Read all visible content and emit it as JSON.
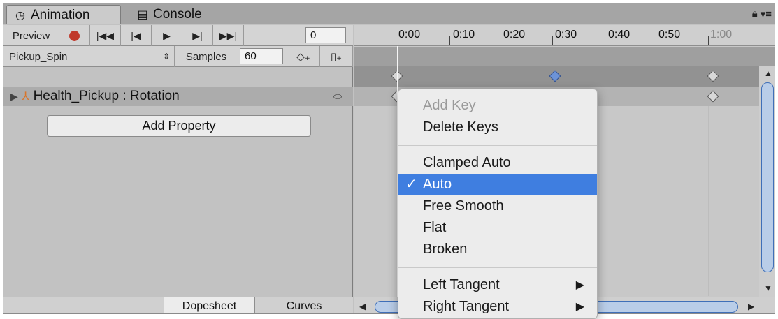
{
  "tabs": [
    {
      "label": "Animation",
      "icon": "clock-icon"
    },
    {
      "label": "Console",
      "icon": "console-icon"
    }
  ],
  "toolbar": {
    "preview_label": "Preview",
    "frame_value": "0",
    "clip_name": "Pickup_Spin",
    "samples_label": "Samples",
    "samples_value": "60"
  },
  "property": {
    "label": "Health_Pickup : Rotation"
  },
  "add_property_label": "Add Property",
  "bottom_tabs": {
    "dopesheet": "Dopesheet",
    "curves": "Curves"
  },
  "ruler": {
    "ticks": [
      "0:00",
      "0:10",
      "0:20",
      "0:30",
      "0:40",
      "0:50",
      "1:00"
    ]
  },
  "context_menu": {
    "items": [
      {
        "label": "Add Key",
        "disabled": true
      },
      {
        "label": "Delete Keys",
        "disabled": false
      },
      {
        "label": "Clamped Auto",
        "disabled": false
      },
      {
        "label": "Auto",
        "checked": true
      },
      {
        "label": "Free Smooth",
        "disabled": false
      },
      {
        "label": "Flat",
        "disabled": false
      },
      {
        "label": "Broken",
        "disabled": false
      },
      {
        "label": "Left Tangent",
        "submenu": true
      },
      {
        "label": "Right Tangent",
        "submenu": true
      }
    ],
    "check_mark": "✓",
    "submenu_arrow": "▶"
  },
  "colors": {
    "selection": "#3f7ee0",
    "record": "#c0392b"
  }
}
